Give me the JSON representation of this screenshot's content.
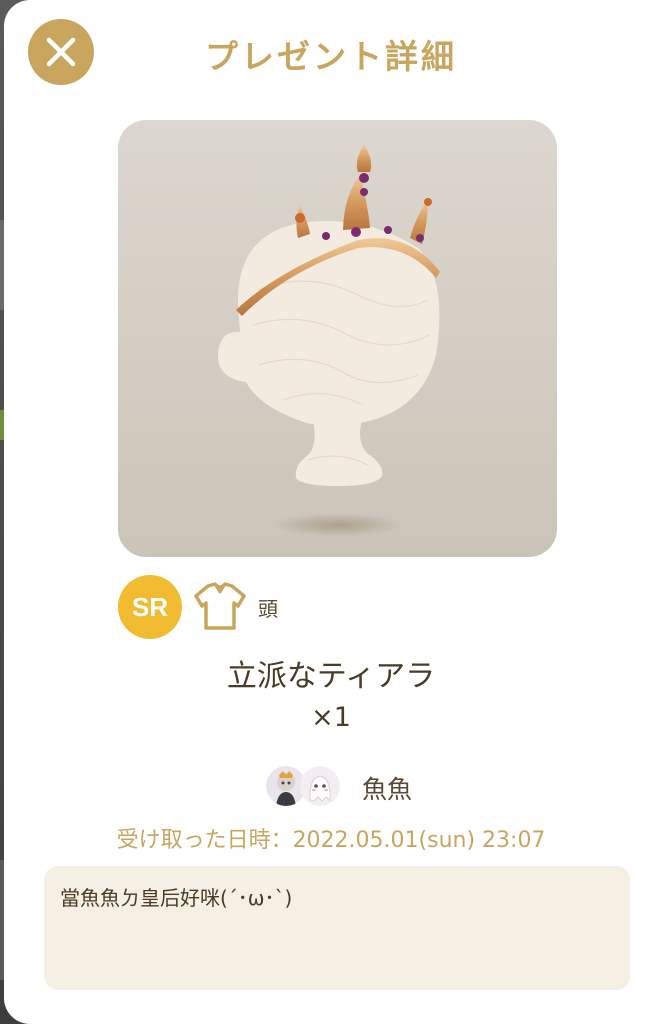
{
  "modal": {
    "title": "プレゼント詳細",
    "close_icon": "close-icon"
  },
  "item": {
    "image_icon": "tiara-mannequin-image",
    "rarity": "SR",
    "rarity_color": "#f2bc32",
    "category_icon": "shirt-icon",
    "category": "頭",
    "name": "立派なティアラ",
    "quantity": "×1"
  },
  "sender": {
    "name": "魚魚",
    "avatar_icons": [
      "avatar-knight",
      "avatar-ghost"
    ]
  },
  "received": {
    "text": "受け取った日時：2022.05.01(sun) 23:07"
  },
  "message": {
    "text": "當魚魚ㄉ皇后好咪(´･ω･`)"
  },
  "colors": {
    "accent_gold": "#c9a55d",
    "text_brown": "#4b3b26",
    "message_bg": "#f6efe4"
  }
}
